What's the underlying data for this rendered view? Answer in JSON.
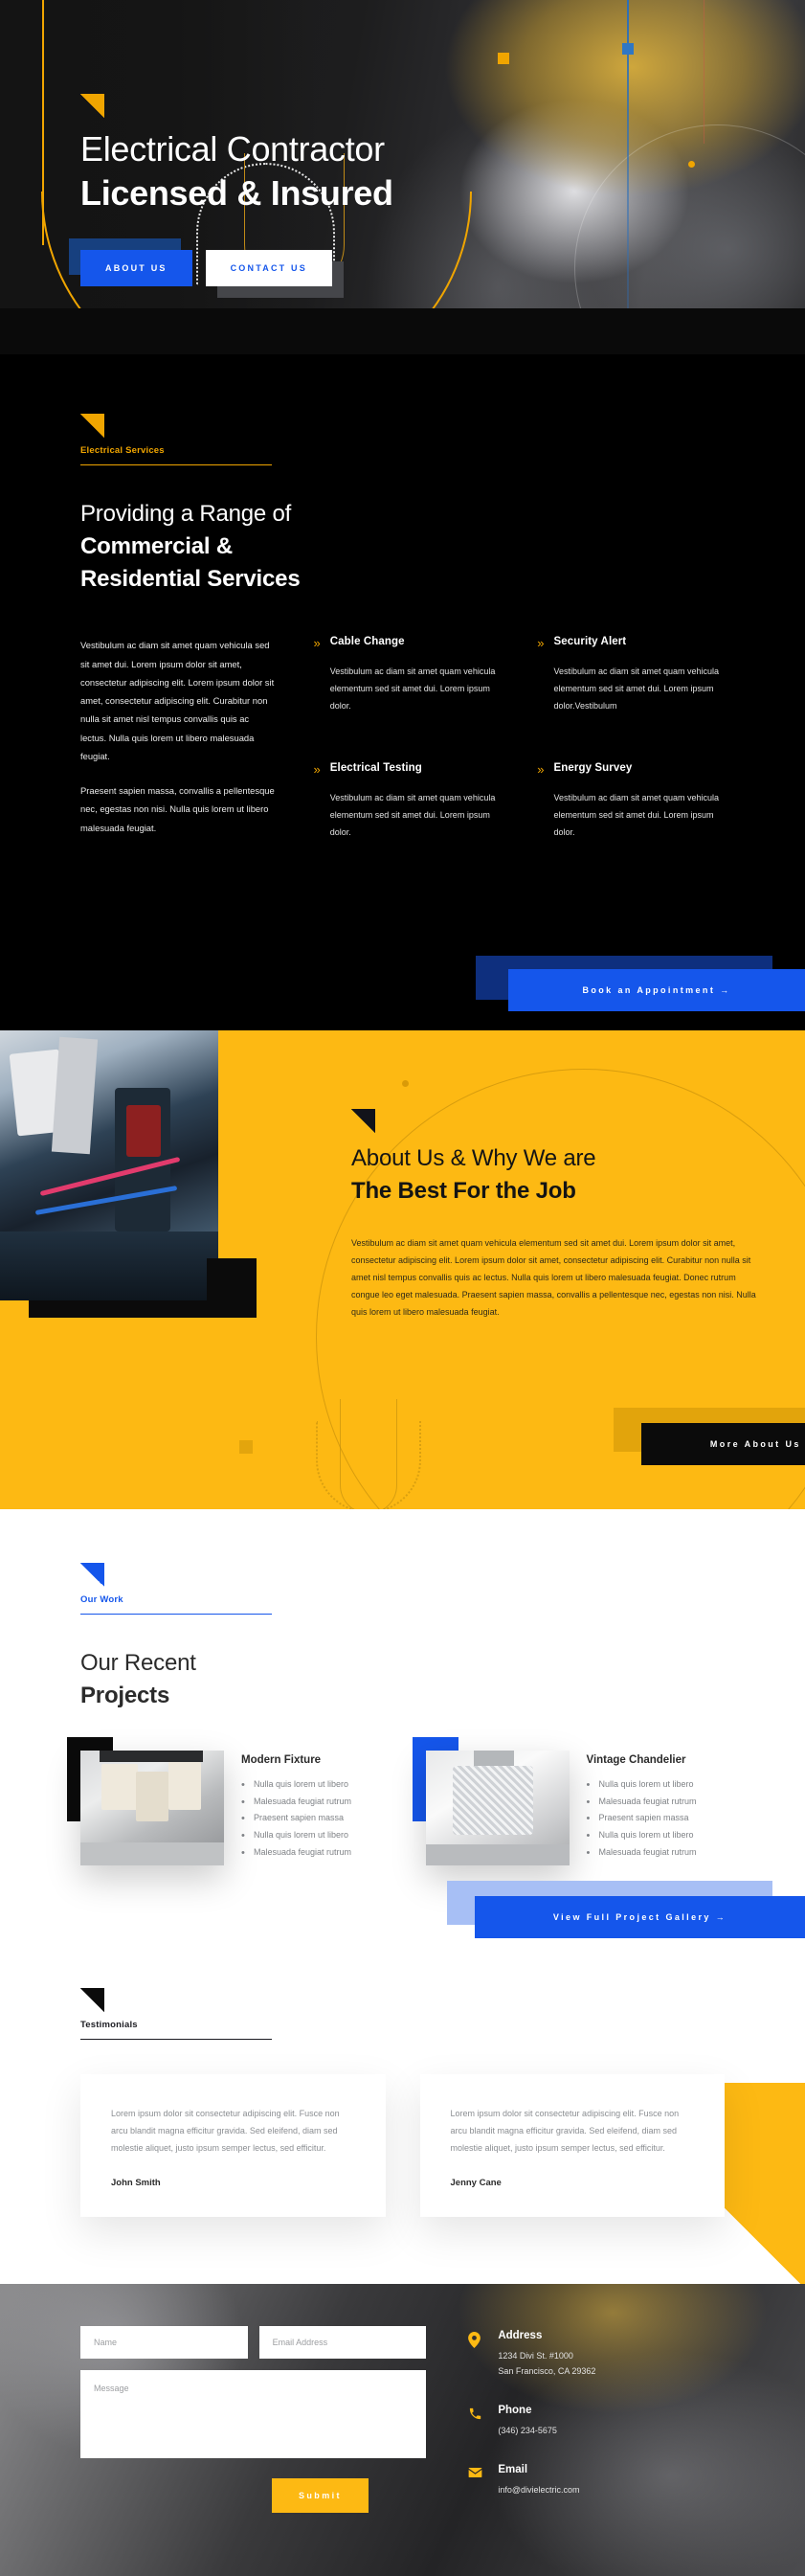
{
  "hero": {
    "title_line1": "Electrical Contractor",
    "title_line2": "Licensed & Insured",
    "btn_about": "About Us",
    "btn_contact": "Contact Us"
  },
  "services": {
    "eyebrow": "Electrical Services",
    "title_line1": "Providing a Range of",
    "title_line2": "Commercial &",
    "title_line3": "Residential Services",
    "paragraph1": "Vestibulum ac diam sit amet quam vehicula sed sit amet dui. Lorem ipsum dolor sit amet, consectetur adipiscing elit. Lorem ipsum dolor sit amet, consectetur adipiscing elit. Curabitur non nulla sit amet nisl tempus convallis quis ac lectus. Nulla quis lorem ut libero malesuada feugiat.",
    "paragraph2": "Praesent sapien massa, convallis a pellentesque nec, egestas non nisi. Nulla quis lorem ut libero malesuada feugiat.",
    "features": [
      {
        "title": "Cable Change",
        "text": "Vestibulum ac diam sit amet quam vehicula elementum sed sit amet dui. Lorem ipsum dolor."
      },
      {
        "title": "Electrical Testing",
        "text": "Vestibulum ac diam sit amet quam vehicula elementum sed sit amet dui. Lorem ipsum dolor."
      },
      {
        "title": "Security Alert",
        "text": "Vestibulum ac diam sit amet quam vehicula elementum sed sit amet dui. Lorem ipsum dolor.Vestibulum"
      },
      {
        "title": "Energy Survey",
        "text": "Vestibulum ac diam sit amet quam vehicula elementum sed sit amet dui. Lorem ipsum dolor."
      }
    ],
    "cta": "Book an Appointment  →"
  },
  "about": {
    "title_line1": "About Us & Why We are",
    "title_line2": "The Best For the Job",
    "body": "Vestibulum ac diam sit amet quam vehicula elementum sed sit amet dui. Lorem ipsum dolor sit amet, consectetur adipiscing elit. Lorem ipsum dolor sit amet, consectetur adipiscing elit. Curabitur non nulla sit amet nisl tempus convallis quis ac lectus. Nulla quis lorem ut libero malesuada feugiat. Donec rutrum congue leo eget malesuada. Praesent sapien massa, convallis a pellentesque nec, egestas non nisi. Nulla quis lorem ut libero malesuada feugiat.",
    "cta": "More About Us  →"
  },
  "projects": {
    "eyebrow": "Our Work",
    "title_line1": "Our Recent",
    "title_line2": "Projects",
    "items": [
      {
        "title": "Modern Fixture",
        "bullets": [
          "Nulla quis lorem ut libero",
          "Malesuada feugiat rutrum",
          "Praesent sapien massa",
          "Nulla quis lorem ut libero",
          "Malesuada feugiat rutrum"
        ]
      },
      {
        "title": "Vintage Chandelier",
        "bullets": [
          "Nulla quis lorem ut libero",
          "Malesuada feugiat rutrum",
          "Praesent sapien massa",
          "Nulla quis lorem ut libero",
          "Malesuada feugiat rutrum"
        ]
      }
    ],
    "cta": "View Full Project Gallery  →"
  },
  "testimonials": {
    "eyebrow": "Testimonials",
    "items": [
      {
        "quote": "Lorem ipsum dolor sit consectetur adipiscing elit. Fusce non arcu blandit magna efficitur gravida. Sed eleifend, diam sed molestie aliquet, justo ipsum semper lectus, sed efficitur.",
        "name": "John Smith"
      },
      {
        "quote": "Lorem ipsum dolor sit consectetur adipiscing elit. Fusce non arcu blandit magna efficitur gravida. Sed eleifend, diam sed molestie aliquet, justo ipsum semper lectus, sed efficitur.",
        "name": "Jenny Cane"
      }
    ]
  },
  "contact": {
    "name_placeholder": "Name",
    "email_placeholder": "Email Address",
    "message_placeholder": "Message",
    "submit_label": "Submit",
    "address_title": "Address",
    "address_line1": "1234 Divi St. #1000",
    "address_line2": "San Francisco, CA 29362",
    "phone_title": "Phone",
    "phone_value": "(346) 234-5675",
    "email_title": "Email",
    "email_value": "info@divielectric.com"
  },
  "colors": {
    "yellow": "#fdb913",
    "accent_yellow": "#f0a500",
    "blue": "#1556eb",
    "dark": "#000000"
  }
}
